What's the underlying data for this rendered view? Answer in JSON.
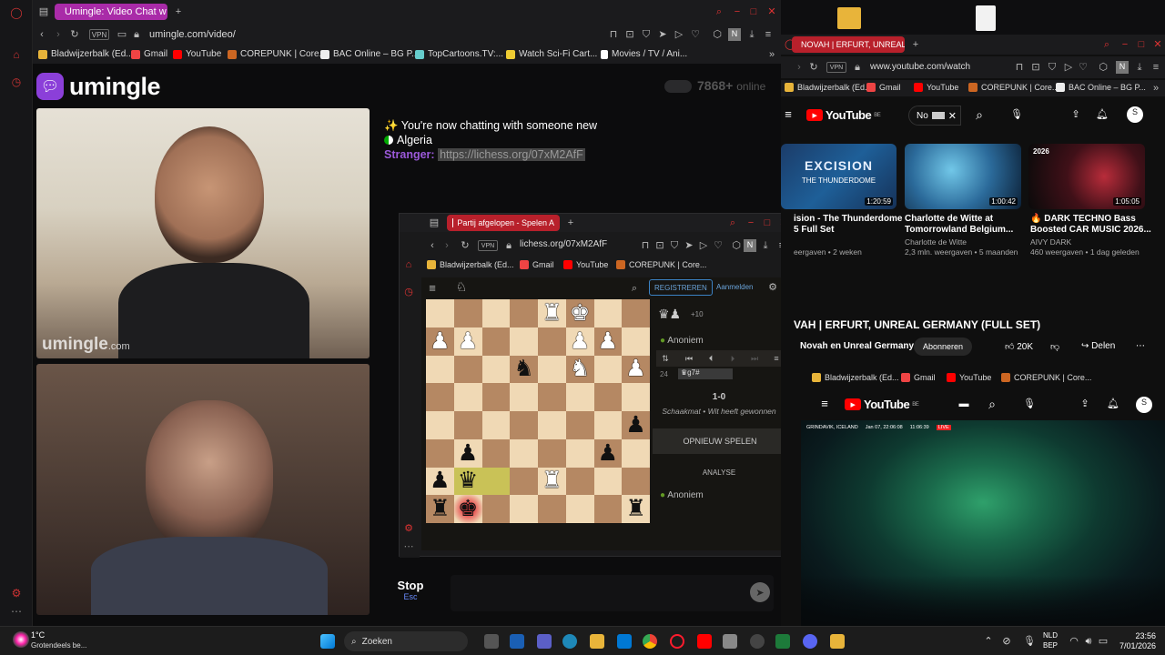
{
  "browser1": {
    "tab_title": "Umingle: Video Chat w",
    "url": "umingle.com/video/",
    "bookmarks": [
      "Bladwijzerbalk (Ed...",
      "Gmail",
      "YouTube",
      "COREPUNK | Core...",
      "BAC Online – BG P...",
      "TopCartoons.TV:...",
      "Watch Sci-Fi Cart...",
      "Movies / TV / Ani..."
    ]
  },
  "umingle": {
    "logo": "umingle",
    "online_count": "7868+",
    "online_label": "online",
    "cam_watermark": "umingle",
    "cam_watermark_suffix": ".com",
    "chat_status": "✨ You're now chatting with someone new",
    "country": "Algeria",
    "stranger_label": "Stranger:",
    "stranger_message": "https://lichess.org/07xM2AfF",
    "stop_label": "Stop",
    "stop_hint": "Esc"
  },
  "browser2": {
    "tab_title": "Partij afgelopen - Spelen A",
    "url": "lichess.org/07xM2AfF",
    "bookmarks": [
      "Bladwijzerbalk (Ed...",
      "Gmail",
      "YouTube",
      "COREPUNK | Core..."
    ]
  },
  "lichess": {
    "register_label": "REGISTREREN",
    "login_label": "Aanmelden",
    "material": "+10",
    "player_top": "Anoniem",
    "move_number": "24",
    "last_move": "♛g7#",
    "result": "1-0",
    "result_text": "Schaakmat • Wit heeft gewonnen",
    "rematch_label": "OPNIEUW SPELEN",
    "analysis_label": "ANALYSE",
    "player_bottom": "Anoniem",
    "board": [
      [
        "",
        "",
        "",
        "",
        "R",
        "K",
        "",
        ""
      ],
      [
        "P",
        "P",
        "",
        "",
        "",
        "P",
        "P",
        ""
      ],
      [
        "",
        "",
        "",
        "n",
        "",
        "N",
        "",
        "P"
      ],
      [
        "",
        "",
        "",
        "",
        "",
        "",
        "",
        ""
      ],
      [
        "",
        "",
        "",
        "",
        "",
        "",
        "",
        "p"
      ],
      [
        "",
        "p",
        "",
        "",
        "",
        "",
        "p",
        ""
      ],
      [
        "p",
        "q",
        "",
        "",
        "R",
        "",
        "",
        ""
      ],
      [
        "r",
        "k",
        "",
        "",
        "",
        "",
        "",
        "r"
      ]
    ]
  },
  "browser3": {
    "tab_title": "NOVAH | ERFURT, UNREAL",
    "url": "www.youtube.com/watch",
    "bookmarks": [
      "Bladwijzerbalk (Ed...",
      "Gmail",
      "YouTube",
      "COREPUNK | Core...",
      "BAC Online – BG P..."
    ],
    "search_value": "No",
    "logo": "YouTube",
    "logo_region": "BE",
    "videos": [
      {
        "title": "ision - The Thunderdome",
        "title2": "5 Full Set",
        "channel": "",
        "meta": "eergaven • 2 weken",
        "duration": "1:20:59",
        "thumb_text": "EXCISION",
        "thumb_sub": "THE THUNDERDOME"
      },
      {
        "title": "Charlotte de Witte at",
        "title2": "Tomorrowland Belgium...",
        "channel": "Charlotte de Witte",
        "meta": "2,3 mln. weergaven • 5 maanden",
        "duration": "1:00:42",
        "thumb_text": "",
        "thumb_sub": ""
      },
      {
        "title": "🔥 DARK TECHNO Bass",
        "title2": "Boosted CAR MUSIC 2026...",
        "channel": "AIVY DARK",
        "meta": "460 weergaven • 1 dag geleden",
        "duration": "1:05:05",
        "thumb_text": "2026",
        "thumb_sub": ""
      }
    ],
    "stream_title": "VAH | ERFURT, UNREAL GERMANY (FULL SET)",
    "channel": "Novah en Unreal Germany",
    "subscribe": "Abonneren",
    "likes": "20K",
    "share": "Delen",
    "live_overlay": "GRINDAVIK, ICELAND",
    "live_date": "Jan 07, 22:06:08",
    "live_time": "11:06:39",
    "live_badge": "LIVE"
  },
  "taskbar": {
    "weather_temp": "1°C",
    "weather_text": "Grotendeels be...",
    "search": "Zoeken",
    "lang": "NLD",
    "lang_sub": "BEP",
    "time": "23:56",
    "date": "7/01/2026"
  },
  "colors": {
    "accent_purple": "#8b3fd9",
    "opera_red": "#ff1b2d",
    "yt_red": "#ff0000",
    "board_light": "#f0d9b5",
    "board_dark": "#b58863"
  }
}
